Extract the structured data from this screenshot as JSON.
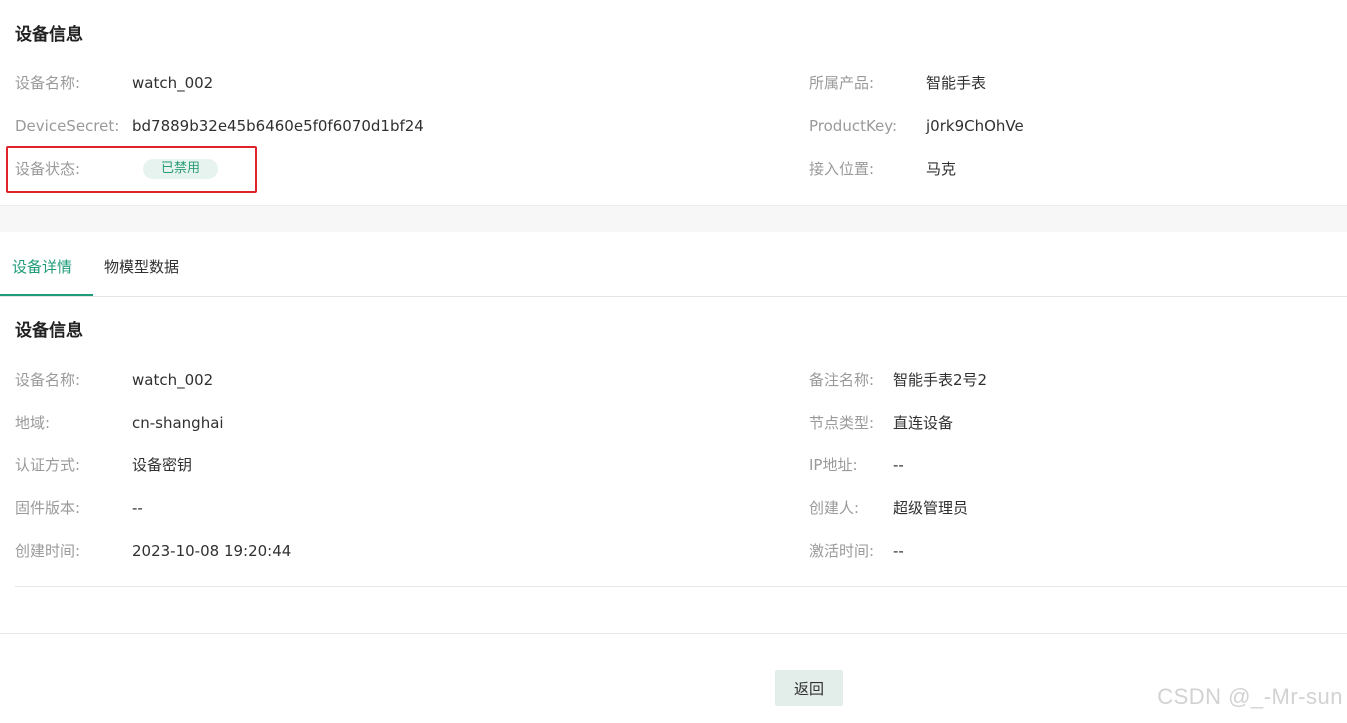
{
  "summary": {
    "title": "设备信息",
    "fields": {
      "device_name": {
        "label": "设备名称:",
        "value": "watch_002"
      },
      "product": {
        "label": "所属产品:",
        "value": "智能手表"
      },
      "device_secret": {
        "label": "DeviceSecret:",
        "value": "bd7889b32e45b6460e5f0f6070d1bf24"
      },
      "product_key": {
        "label": "ProductKey:",
        "value": "j0rk9ChOhVe"
      },
      "device_status": {
        "label": "设备状态:",
        "value": "已禁用"
      },
      "access_location": {
        "label": "接入位置:",
        "value": "马克"
      }
    }
  },
  "tabs": [
    {
      "label": "设备详情",
      "active": true
    },
    {
      "label": "物模型数据",
      "active": false
    }
  ],
  "details": {
    "title": "设备信息",
    "fields": {
      "device_name": {
        "label": "设备名称:",
        "value": "watch_002"
      },
      "remark_name": {
        "label": "备注名称:",
        "value": "智能手表2号2"
      },
      "region": {
        "label": "地域:",
        "value": "cn-shanghai"
      },
      "node_type": {
        "label": "节点类型:",
        "value": "直连设备"
      },
      "auth_method": {
        "label": "认证方式:",
        "value": "设备密钥"
      },
      "ip_address": {
        "label": "IP地址:",
        "value": "--"
      },
      "firmware_version": {
        "label": "固件版本:",
        "value": "--"
      },
      "creator": {
        "label": "创建人:",
        "value": "超级管理员"
      },
      "created_time": {
        "label": "创建时间:",
        "value": "2023-10-08 19:20:44"
      },
      "activated_time": {
        "label": "激活时间:",
        "value": "--"
      }
    }
  },
  "footer": {
    "back_label": "返回"
  },
  "watermark": "CSDN @_-Mr-sun",
  "colors": {
    "accent": "#1f9b78",
    "highlight_border": "#e0232a",
    "status_badge_bg": "#e6f3ef",
    "status_badge_text": "#2a9d74"
  }
}
